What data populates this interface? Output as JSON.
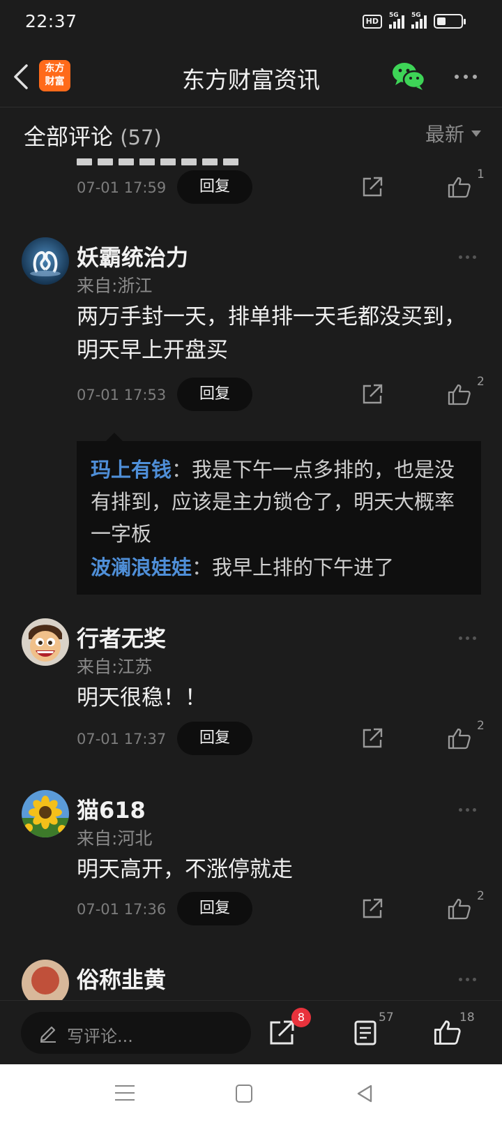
{
  "status_bar": {
    "time": "22:37",
    "hd_label": "HD",
    "network_1": "5G",
    "network_2": "5G",
    "battery_level": 0.35
  },
  "header": {
    "logo_text_1": "东方",
    "logo_text_2": "财富",
    "title": "东方财富资讯",
    "accent_color": "#ff6a1a",
    "icons": [
      "back-icon",
      "wechat-icon",
      "more-icon"
    ]
  },
  "section": {
    "title": "全部评论",
    "count": "(57)",
    "sort_label": "最新"
  },
  "comments": [
    {
      "time": "07-01 17:59",
      "reply_label": "回复",
      "likes": "1"
    },
    {
      "name": "妖霸统治力",
      "location": "来自:浙江",
      "body": "两万手封一天，排单排一天毛都没买到，明天早上开盘买",
      "time": "07-01 17:53",
      "reply_label": "回复",
      "likes": "2",
      "replies": [
        {
          "user": "玛上有钱",
          "sep": "：",
          "text": "我是下午一点多排的，也是没有排到，应该是主力锁仓了，明天大概率一字板"
        },
        {
          "user": "波澜浪娃娃",
          "sep": "：",
          "text": "我早上排的下午进了"
        }
      ]
    },
    {
      "name": "行者无奖",
      "location": "来自:江苏",
      "body": "明天很稳！！",
      "time": "07-01 17:37",
      "reply_label": "回复",
      "likes": "2"
    },
    {
      "name": "猫618",
      "location": "来自:河北",
      "body": "明天高开，不涨停就走",
      "time": "07-01 17:36",
      "reply_label": "回复",
      "likes": "2"
    },
    {
      "name": "俗称韭黄"
    }
  ],
  "bottom_bar": {
    "input_placeholder": "写评论...",
    "share_badge": "8",
    "comments_count": "57",
    "likes_count": "18",
    "badge_color": "#e8323c"
  },
  "colors": {
    "background": "#1c1c1c",
    "reply_user": "#4f8fd8"
  }
}
